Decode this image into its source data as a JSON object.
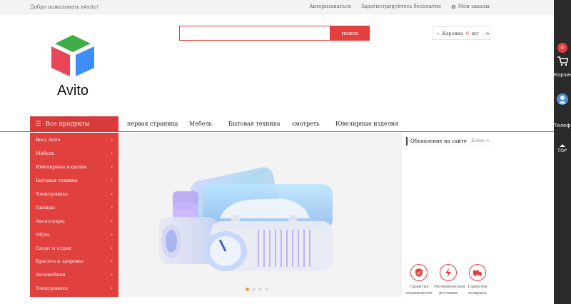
{
  "topbar": {
    "welcome": "Добро пожаловать вAvito！",
    "login": "Авторизоваться",
    "register": "Зарегистрируйтесь бесплатно",
    "orders": "Мои заказы"
  },
  "header": {
    "logo_text": "Avito",
    "search_placeholder": "",
    "search_button": "поиск",
    "cart_label": "Корзина",
    "cart_count": "0",
    "cart_unit": "шт",
    "cart_arrow": ">"
  },
  "nav": {
    "all_products": "Все продукты",
    "links": [
      "первая страница",
      "Мебель",
      "Бытовая техника",
      "смотреть",
      "Ювелирные изделия"
    ]
  },
  "categories": [
    "Весь Avito",
    "Мебель",
    "Ювелирные изделия",
    "Бытовая техника",
    "Электроника",
    "Одежда",
    "Аксессуары",
    "Обувь",
    "Спорт и отдых",
    "Красота и здоровье",
    "Автомобили",
    "Электроника"
  ],
  "banner": {
    "slides": 4,
    "active_slide": 1
  },
  "notice": {
    "title": "Объявление на сайте",
    "more": "Более >",
    "guarantees": [
      {
        "line1": "Гарантия",
        "line2": "подлинности",
        "icon": "shield-check-icon"
      },
      {
        "line1": "Молниеносная",
        "line2": "доставка",
        "icon": "lightning-icon"
      },
      {
        "line1": "Гарантия",
        "line2": "возврата",
        "icon": "truck-icon"
      }
    ]
  },
  "rail": {
    "cart_badge": "0",
    "cart_label": "Корзина",
    "phone_label": "Телефон",
    "top_label": "TOP"
  },
  "colors": {
    "accent": "#e2403f",
    "rail": "#2a2a2a"
  }
}
